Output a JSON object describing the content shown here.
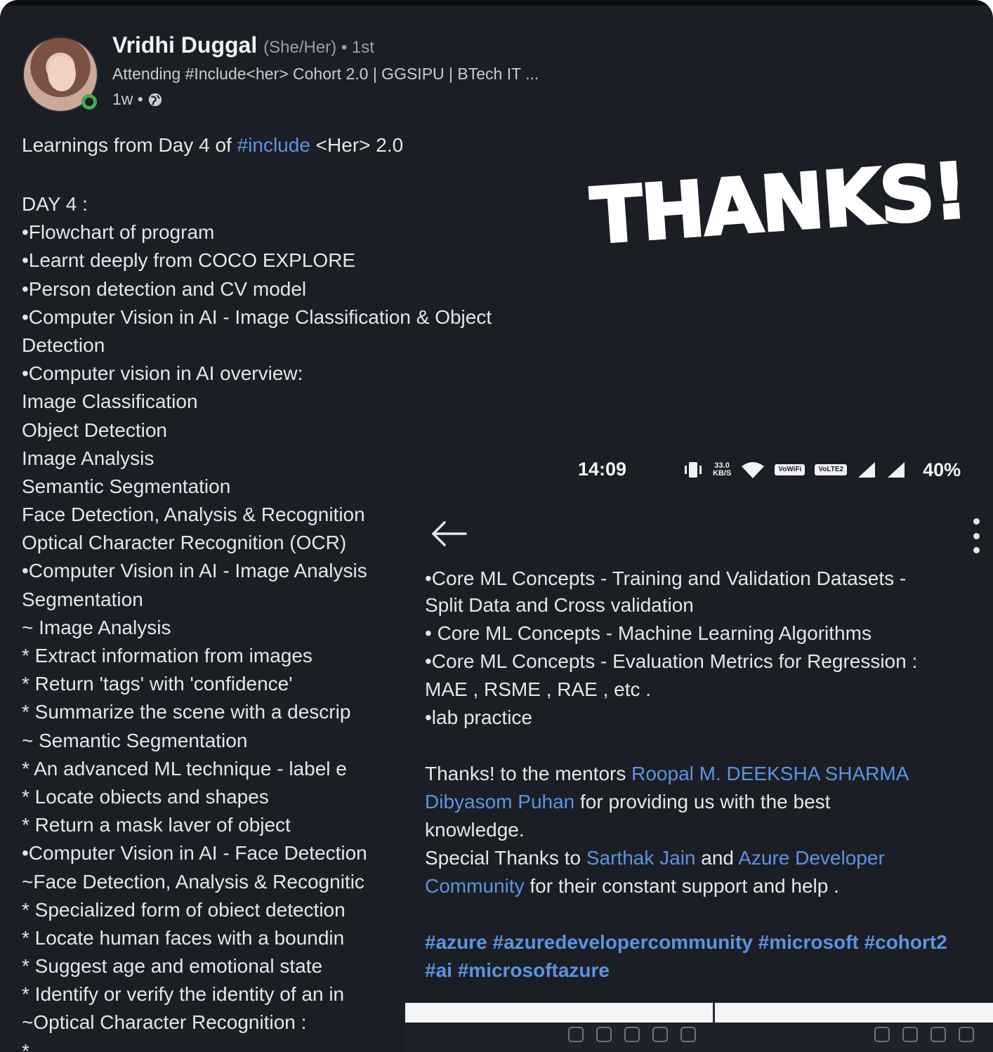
{
  "post": {
    "author": {
      "name": "Vridhi Duggal",
      "pronouns": "(She/Her) • 1st",
      "headline": "Attending #Include<her> Cohort 2.0 | GGSIPU | BTech IT ...",
      "time": "1w •"
    },
    "intro": {
      "prefix": "Learnings from Day 4 of ",
      "hashtag": "#include",
      "suffix": " <Her> 2.0"
    },
    "left_lines": [
      "DAY 4 :",
      "•Flowchart of program",
      "•Learnt deeply from COCO EXPLORE",
      "•Person detection and CV model",
      "•Computer Vision in AI - Image Classification & Object",
      "Detection",
      "•Computer vision in AI overview:",
      "Image Classification",
      "Object Detection",
      "Image Analysis",
      "Semantic Segmentation",
      "Face Detection, Analysis & Recognition",
      "Optical Character Recognition (OCR)",
      "•Computer Vision in AI - Image Analysis",
      "Segmentation",
      "~ Image Analysis",
      "*  Extract information from images",
      "*  Return 'tags' with 'confidence'",
      "*  Summarize the scene with a descrip",
      "~ Semantic Segmentation",
      "*  An advanced ML technique - label e",
      "*  Locate obiects and shapes",
      "*  Return a mask laver of object",
      "•Computer Vision in AI - Face Detection",
      "~Face Detection, Analysis & Recognitic",
      "*  Specialized form of obiect detection",
      "*  Locate human faces with a boundin",
      "*  Suggest age and emotional state",
      "*  Identify or verify the identity of an in",
      "~Optical Character Recognition :",
      "*"
    ]
  },
  "sticker": {
    "text": "THANKS!"
  },
  "overlay": {
    "status_bar": {
      "time": "14:09",
      "net_speed_value": "33.0",
      "net_speed_unit": "KB/S",
      "volte1": "VoWiFi",
      "volte2": "VoLTE2",
      "battery": "40%"
    },
    "lines": {
      "l1": "•Core ML Concepts - Training and Validation Datasets -",
      "l2": "Split Data and  Cross validation",
      "l3": "• Core ML Concepts - Machine Learning Algorithms",
      "l4": "•Core ML Concepts - Evaluation Metrics for Regression :",
      "l5": "MAE , RSME , RAE , etc .",
      "l6": "•lab practice"
    },
    "thanks": {
      "prefix": "Thanks! to the mentors ",
      "mentor1": "Roopal M.",
      "mentor2": "DEEKSHA SHARMA",
      "mentor3": "Dibyasom Puhan",
      "after_mentor3": " for providing us with the best",
      "line3": "knowledge.",
      "special_prefix": "Special Thanks to ",
      "person": "Sarthak Jain",
      "and_text": " and ",
      "org_part1": "Azure Developer",
      "org_part2": "Community",
      "special_suffix": " for their constant support and help ."
    },
    "hashtags_line1": [
      "#azure",
      "#azuredevelopercommunity",
      "#microsoft",
      "#cohort2"
    ],
    "hashtags_line2": [
      "#ai",
      "#microsoftazure"
    ]
  }
}
